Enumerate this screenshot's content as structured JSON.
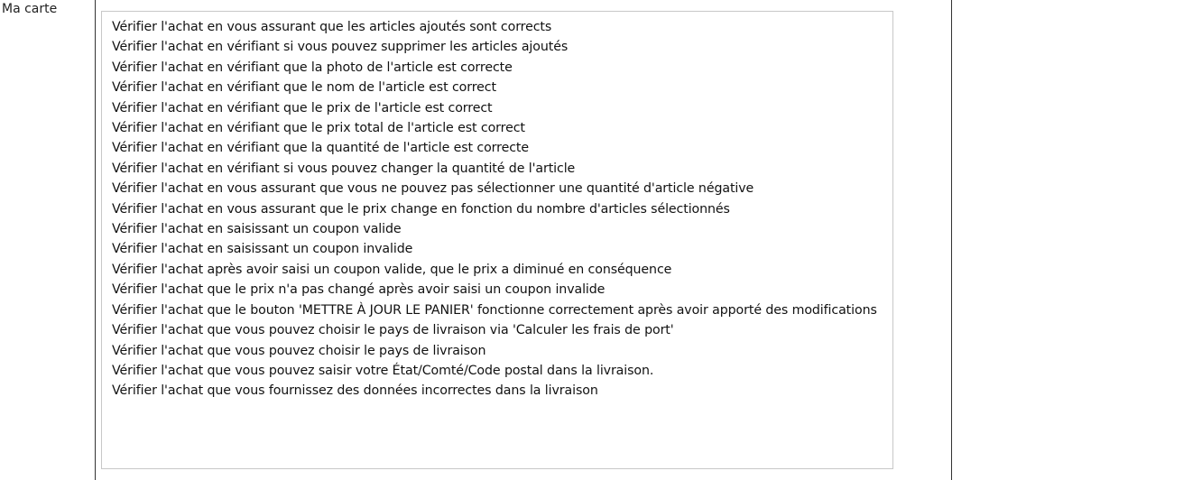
{
  "label": "Ma carte",
  "items": [
    "Vérifier l'achat en vous assurant que les articles ajoutés sont corrects",
    "Vérifier l'achat en vérifiant si vous pouvez supprimer les articles ajoutés",
    "Vérifier l'achat en vérifiant que la photo de l'article est correcte",
    "Vérifier l'achat en vérifiant que le nom de l'article est correct",
    "Vérifier l'achat en vérifiant que le prix de l'article est correct",
    "Vérifier l'achat en vérifiant que le prix total de l'article est correct",
    "Vérifier l'achat en vérifiant que la quantité de l'article est correcte",
    "Vérifier l'achat en vérifiant si vous pouvez changer la quantité de l'article",
    "Vérifier l'achat en vous assurant que vous ne pouvez pas sélectionner une quantité d'article négative",
    "Vérifier l'achat en vous assurant que le prix change en fonction du nombre d'articles sélectionnés",
    "Vérifier l'achat en saisissant un coupon valide",
    "Vérifier l'achat en saisissant un coupon invalide",
    "Vérifier l'achat après avoir saisi un coupon valide, que le prix a diminué en conséquence",
    "Vérifier l'achat que le prix n'a pas changé après avoir saisi un coupon invalide",
    "Vérifier l'achat que le bouton 'METTRE À JOUR LE PANIER' fonctionne correctement après avoir apporté des modifications",
    "Vérifier l'achat que vous pouvez choisir le pays de livraison via 'Calculer les frais de port'",
    "Vérifier l'achat que vous pouvez choisir le pays de livraison",
    "Vérifier l'achat que vous pouvez saisir votre État/Comté/Code postal dans la livraison.",
    "Vérifier l'achat que vous fournissez des données incorrectes dans la livraison"
  ]
}
